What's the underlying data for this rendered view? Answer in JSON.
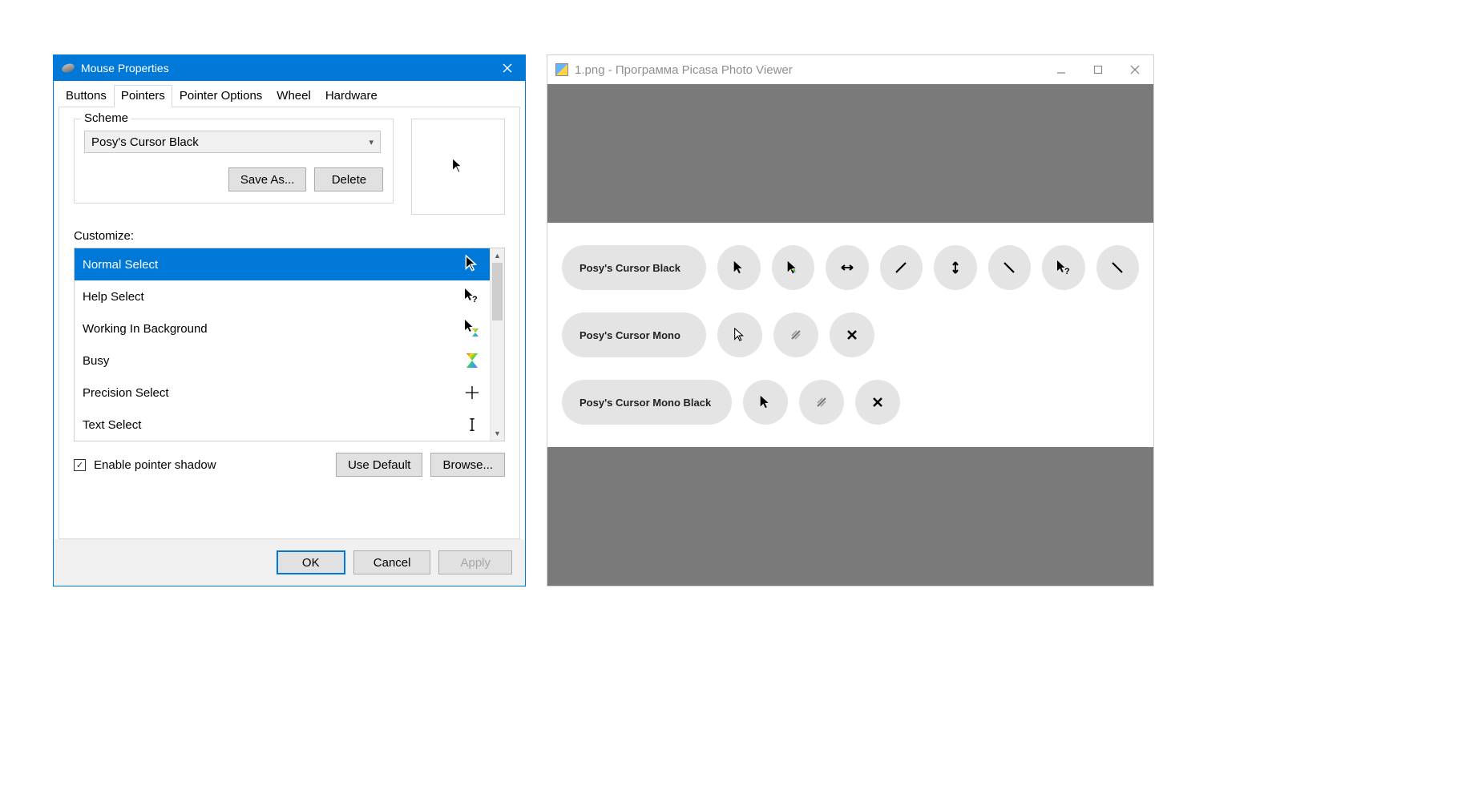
{
  "mouse_properties": {
    "title": "Mouse Properties",
    "tabs": [
      "Buttons",
      "Pointers",
      "Pointer Options",
      "Wheel",
      "Hardware"
    ],
    "active_tab": 1,
    "scheme": {
      "label": "Scheme",
      "selected": "Posy's Cursor Black",
      "save_as": "Save As...",
      "delete": "Delete"
    },
    "customize_label": "Customize:",
    "cursors": [
      {
        "name": "Normal Select",
        "icon": "arrow-black",
        "selected": true
      },
      {
        "name": "Help Select",
        "icon": "arrow-help"
      },
      {
        "name": "Working In Background",
        "icon": "arrow-busy"
      },
      {
        "name": "Busy",
        "icon": "busy-rainbow"
      },
      {
        "name": "Precision Select",
        "icon": "crosshair"
      },
      {
        "name": "Text Select",
        "icon": "ibeam"
      }
    ],
    "enable_shadow": {
      "label": "Enable pointer shadow",
      "checked": true
    },
    "use_default": "Use Default",
    "browse": "Browse...",
    "ok": "OK",
    "cancel": "Cancel",
    "apply": "Apply"
  },
  "picasa": {
    "title": "1.png - Программа Picasa Photo Viewer",
    "rows": [
      {
        "label": "Posy's Cursor Black",
        "icons": [
          "arrow-black",
          "arrow-rainbow",
          "resize-h",
          "resize-diag1",
          "resize-v",
          "resize-diag2",
          "arrow-help-small",
          "move-diag"
        ]
      },
      {
        "label": "Posy's Cursor Mono",
        "icons": [
          "arrow-outline",
          "stripes",
          "x-mark"
        ]
      },
      {
        "label": "Posy's Cursor Mono Black",
        "icons": [
          "arrow-black-small",
          "stripes",
          "x-mark"
        ]
      }
    ]
  }
}
